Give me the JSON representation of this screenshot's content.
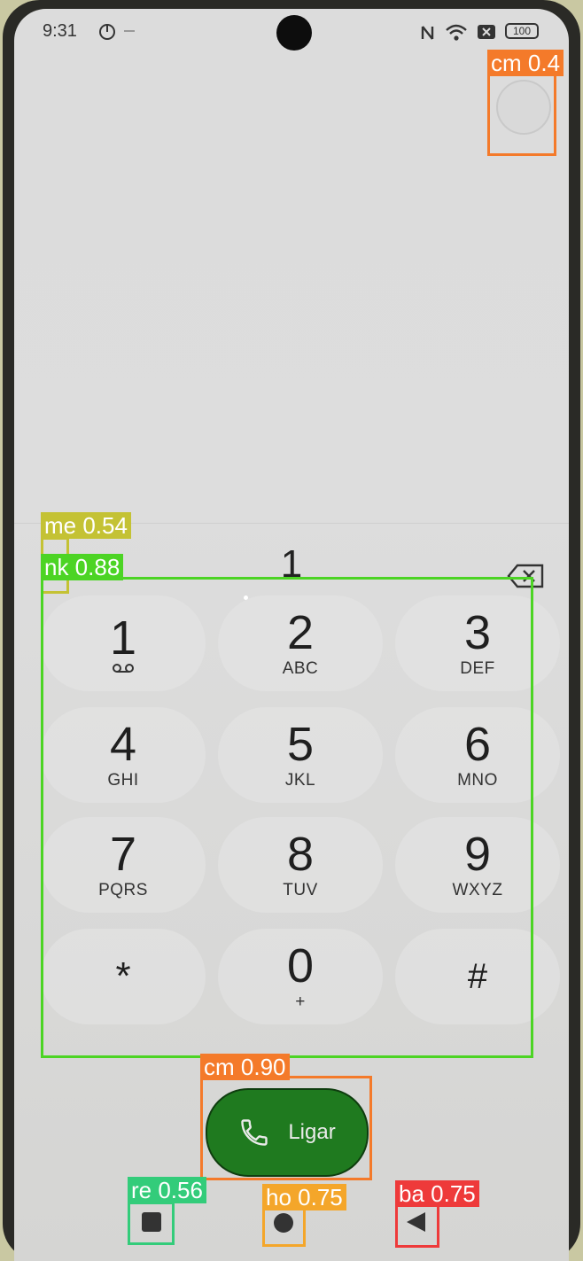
{
  "status_bar": {
    "time": "9:31",
    "battery": "100"
  },
  "dialer": {
    "entered_number": "1",
    "keys": [
      {
        "digit": "1",
        "letters": "∞"
      },
      {
        "digit": "2",
        "letters": "ABC"
      },
      {
        "digit": "3",
        "letters": "DEF"
      },
      {
        "digit": "4",
        "letters": "GHI"
      },
      {
        "digit": "5",
        "letters": "JKL"
      },
      {
        "digit": "6",
        "letters": "MNO"
      },
      {
        "digit": "7",
        "letters": "PQRS"
      },
      {
        "digit": "8",
        "letters": "TUV"
      },
      {
        "digit": "9",
        "letters": "WXYZ"
      },
      {
        "digit": "*",
        "letters": ""
      },
      {
        "digit": "0",
        "letters": "+"
      },
      {
        "digit": "#",
        "letters": ""
      }
    ],
    "call_label": "Ligar"
  },
  "annotations": {
    "cm_top": "cm 0.4",
    "me": "me 0.54",
    "nk": "nk 0.88",
    "cm_call": "cm 0.90",
    "re": "re 0.56",
    "ho": "ho 0.75",
    "ba": "ba 0.75"
  },
  "colors": {
    "call_green": "#1f7a1f",
    "orange": "#f47a2a",
    "lime": "#4cd424",
    "olive": "#c4c234",
    "teal": "#33cc7a",
    "amber": "#f4a62a",
    "red": "#ee3a3a"
  }
}
